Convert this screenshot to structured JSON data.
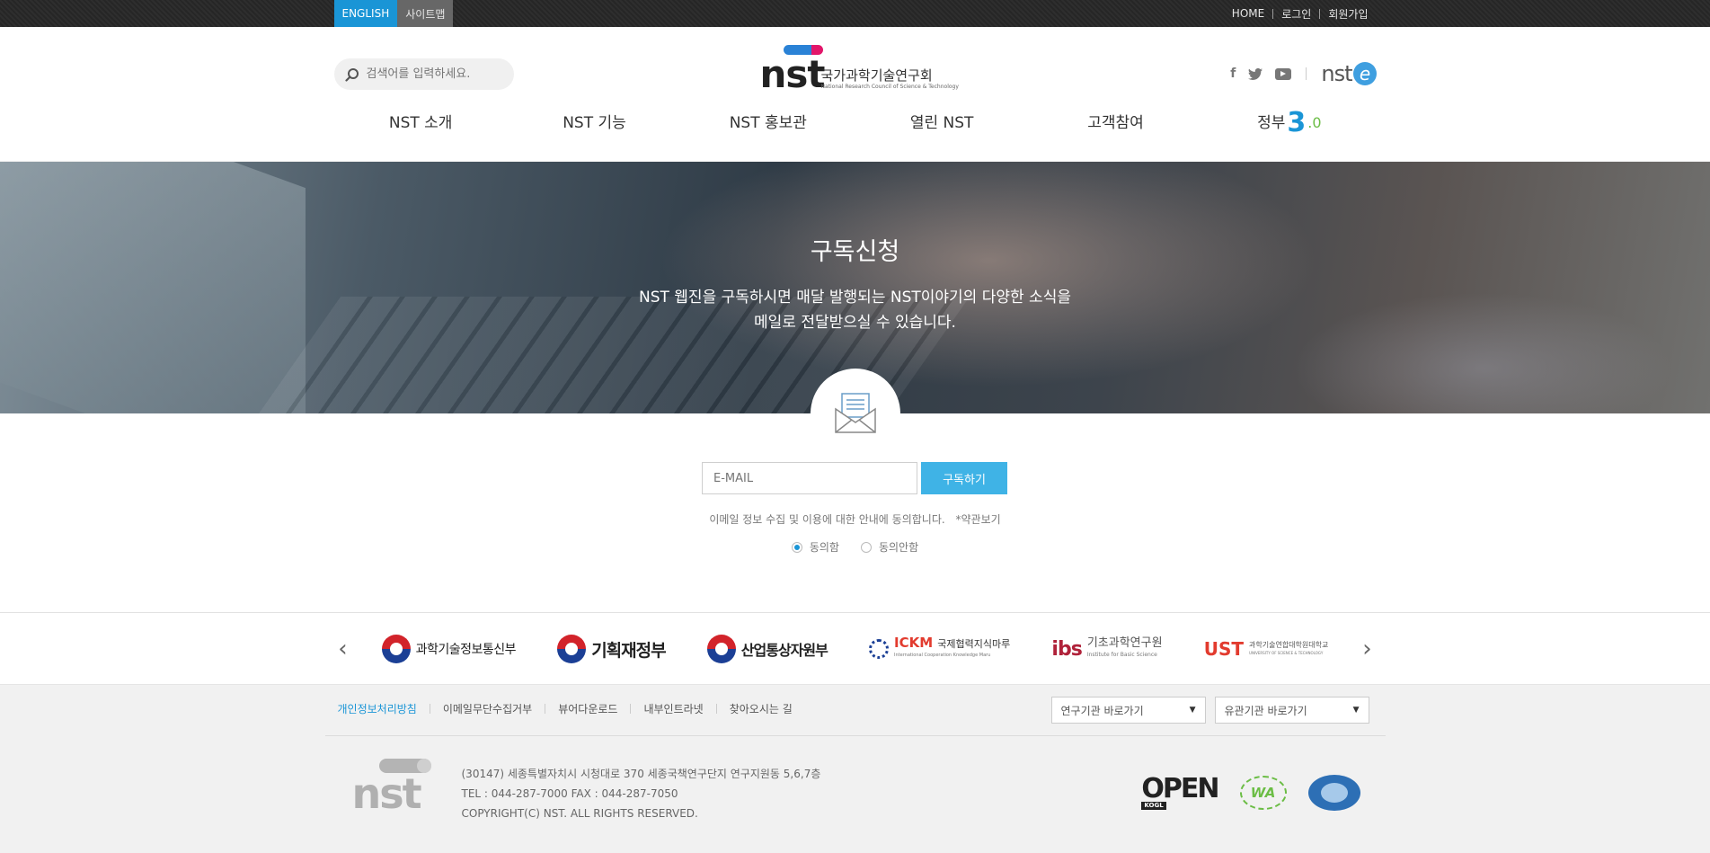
{
  "topbar": {
    "english": "ENGLISH",
    "sitemap": "사이트맵",
    "home": "HOME",
    "login": "로그인",
    "join": "회원가입"
  },
  "header": {
    "search_placeholder": "검색어를 입력하세요.",
    "logo_wordmark": "nst",
    "logo_korean": "국가과학기술연구회",
    "logo_english": "National Research Council of Science & Technology",
    "nste_text": "nst",
    "nste_e": "e",
    "social_icons": [
      "facebook-icon",
      "twitter-icon",
      "youtube-icon"
    ]
  },
  "nav": {
    "items": [
      "NST 소개",
      "NST 기능",
      "NST 홍보관",
      "열린 NST",
      "고객참여"
    ],
    "gov_label": "정부",
    "gov_number": "3",
    "gov_decimal": ".0"
  },
  "hero": {
    "title": "구독신청",
    "line1": "NST 웹진을 구독하시면 매달 발행되는 NST이야기의 다양한 소식을",
    "line2": "메일로 전달받으실 수 있습니다."
  },
  "subscribe": {
    "email_placeholder": "E-MAIL",
    "button": "구독하기",
    "agree_text": "이메일 정보 수집 및 이용에 대한 안내에 동의합니다.",
    "terms_link": "*약관보기",
    "radio_agree": "동의함",
    "radio_disagree": "동의안함",
    "selected": "동의함"
  },
  "partners": {
    "prev": "‹",
    "next": "›",
    "items": [
      {
        "name": "과학기술정보통신부"
      },
      {
        "name": "기획재정부"
      },
      {
        "name": "산업통상자원부"
      },
      {
        "brand": "ICKM",
        "name": "국제협력지식마루",
        "sub": "International Cooperation Knowledge Maru"
      },
      {
        "brand": "ibs",
        "name": "기초과학연구원",
        "sub": "Institute for Basic Science"
      },
      {
        "brand": "UST",
        "name": "과학기술연합대학원대학교",
        "sub": "UNIVERSITY OF SCIENCE & TECHNOLOGY"
      }
    ]
  },
  "footer": {
    "links": [
      "개인정보처리방침",
      "이메일무단수집거부",
      "뷰어다운로드",
      "내부인트라넷",
      "찾아오시는 길"
    ],
    "select1": "연구기관 바로가기",
    "select2": "유관기관 바로가기",
    "logo_word": "nst",
    "address": "(30147) 세종특별자치시 시청대로 370 세종국책연구단지 연구지원동 5,6,7층",
    "tel": "TEL : 044-287-7000 FAX : 044-287-7050",
    "copyright": "COPYRIGHT(C) NST. ALL RIGHTS RESERVED.",
    "badge_open": "OPEN",
    "badge_open_sub": "KOGL",
    "badge_wa": "WA"
  },
  "colors": {
    "accent": "#1a95d6",
    "button": "#3fb3e6",
    "topbar": "#2b2b2b"
  }
}
